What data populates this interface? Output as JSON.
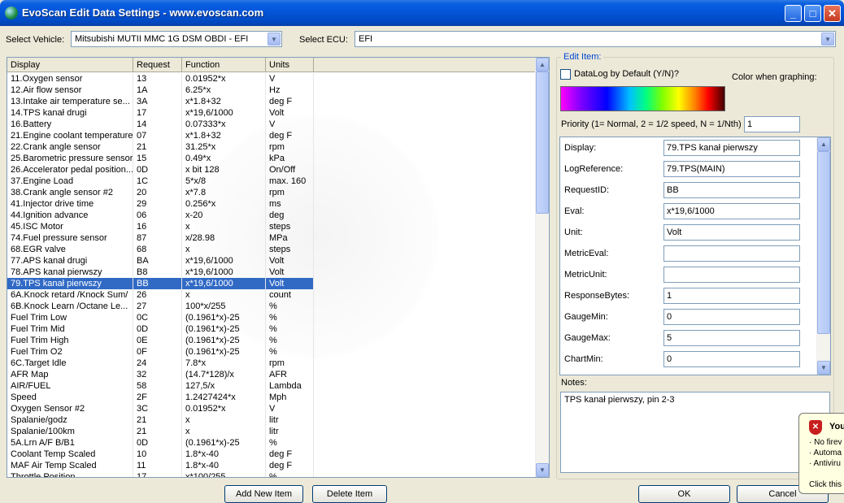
{
  "window": {
    "title": "EvoScan Edit Data Settings - www.evoscan.com",
    "minimize_glyph": "_",
    "maximize_glyph": "□",
    "close_glyph": "✕"
  },
  "vehicle": {
    "label": "Select Vehicle:",
    "value": "Mitsubishi MUTII MMC 1G DSM OBDI - EFI"
  },
  "ecu": {
    "label": "Select ECU:",
    "value": "EFI"
  },
  "icons": {
    "dropdown": "chevron-down",
    "scroll_up": "arrow-up",
    "scroll_down": "arrow-down",
    "logo": "evoscan-globe",
    "shield": "security-shield"
  },
  "table": {
    "columns": [
      "Display",
      "Request",
      "Function",
      "Units"
    ],
    "selected_index": 18,
    "rows": [
      [
        "11.Oxygen sensor",
        "13",
        "0.01952*x",
        "V"
      ],
      [
        "12.Air flow sensor",
        "1A",
        "6.25*x",
        "Hz"
      ],
      [
        "13.Intake air temperature se...",
        "3A",
        "x*1.8+32",
        "deg F"
      ],
      [
        "14.TPS kanał drugi",
        "17",
        "x*19,6/1000",
        "Volt"
      ],
      [
        "16.Battery",
        "14",
        "0.07333*x",
        "V"
      ],
      [
        "21.Engine coolant temperature",
        "07",
        "x*1.8+32",
        "deg F"
      ],
      [
        "22.Crank angle sensor",
        "21",
        "31.25*x",
        "rpm"
      ],
      [
        "25.Barometric pressure sensor",
        "15",
        "0.49*x",
        "kPa"
      ],
      [
        "26.Accelerator pedal position...",
        "0D",
        "x bit 128",
        "On/Off"
      ],
      [
        "37.Engine Load",
        "1C",
        "5*x/8",
        "max. 160"
      ],
      [
        "38.Crank angle sensor #2",
        "20",
        "x*7.8",
        "rpm"
      ],
      [
        "41.Injector drive time",
        "29",
        "0.256*x",
        "ms"
      ],
      [
        "44.Ignition advance",
        "06",
        "x-20",
        "deg"
      ],
      [
        "45.ISC Motor",
        "16",
        "x",
        "steps"
      ],
      [
        "74.Fuel pressure sensor",
        "87",
        "x/28.98",
        "MPa"
      ],
      [
        "68.EGR valve",
        "68",
        "x",
        "steps"
      ],
      [
        "77.APS kanał drugi",
        "BA",
        "x*19,6/1000",
        "Volt"
      ],
      [
        "78.APS kanał pierwszy",
        "B8",
        "x*19,6/1000",
        "Volt"
      ],
      [
        "79.TPS kanał pierwszy",
        "BB",
        "x*19,6/1000",
        "Volt"
      ],
      [
        "6A.Knock retard /Knock Sum/",
        "26",
        "x",
        "count"
      ],
      [
        "6B.Knock Learn /Octane Le...",
        "27",
        "100*x/255",
        "%"
      ],
      [
        "Fuel Trim Low",
        "0C",
        "(0.1961*x)-25",
        "%"
      ],
      [
        "Fuel Trim Mid",
        "0D",
        "(0.1961*x)-25",
        "%"
      ],
      [
        "Fuel Trim High",
        "0E",
        "(0.1961*x)-25",
        "%"
      ],
      [
        "Fuel Trim O2",
        "0F",
        "(0.1961*x)-25",
        "%"
      ],
      [
        "6C.Target Idle",
        "24",
        "7.8*x",
        "rpm"
      ],
      [
        "AFR Map",
        "32",
        "(14.7*128)/x",
        "AFR"
      ],
      [
        "AIR/FUEL",
        "58",
        "127,5/x",
        "Lambda"
      ],
      [
        "Speed",
        "2F",
        "1.2427424*x",
        "Mph"
      ],
      [
        "Oxygen Sensor #2",
        "3C",
        "0.01952*x",
        "V"
      ],
      [
        "Spalanie/godz",
        "21",
        "x",
        "litr"
      ],
      [
        "Spalanie/100km",
        "21",
        "x",
        "litr"
      ],
      [
        "5A.Lrn A/F B/B1",
        "0D",
        "(0.1961*x)-25",
        "%"
      ],
      [
        "Coolant Temp Scaled",
        "10",
        "1.8*x-40",
        "deg F"
      ],
      [
        "MAF Air Temp Scaled",
        "11",
        "1.8*x-40",
        "deg F"
      ],
      [
        "Throttle Position",
        "17",
        "x*100/255",
        "%"
      ]
    ]
  },
  "buttons": {
    "add": "Add New Item",
    "delete": "Delete Item",
    "ok": "OK",
    "cancel": "Cancel"
  },
  "edit": {
    "group_label": "Edit Item:",
    "datalog_label": "DataLog by Default (Y/N)?",
    "datalog_checked": false,
    "color_label": "Color when graphing:",
    "priority_label": "Priority (1= Normal, 2 = 1/2 speed, N = 1/Nth)",
    "priority_value": "1",
    "fields": [
      {
        "label": "Display:",
        "value": "79.TPS kanał pierwszy"
      },
      {
        "label": "LogReference:",
        "value": "79.TPS(MAIN)"
      },
      {
        "label": "RequestID:",
        "value": "BB"
      },
      {
        "label": "Eval:",
        "value": "x*19,6/1000"
      },
      {
        "label": "Unit:",
        "value": "Volt"
      },
      {
        "label": "MetricEval:",
        "value": ""
      },
      {
        "label": "MetricUnit:",
        "value": ""
      },
      {
        "label": "ResponseBytes:",
        "value": "1"
      },
      {
        "label": "GaugeMin:",
        "value": "0"
      },
      {
        "label": "GaugeMax:",
        "value": "5"
      },
      {
        "label": "ChartMin:",
        "value": "0"
      }
    ],
    "notes_label": "Notes:",
    "notes_value": "TPS kanał pierwszy, pin 2-3"
  },
  "popup": {
    "title": "You",
    "items": [
      "· No firev",
      "· Automa",
      "· Antiviru"
    ],
    "footer": "Click this"
  }
}
